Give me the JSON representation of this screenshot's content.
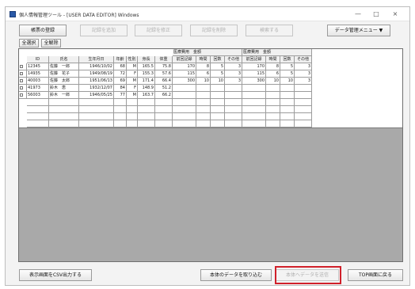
{
  "window": {
    "title": "個人情報管理ツール - [USER DATA EDITOR] Windows",
    "controls": {
      "minimize": "—",
      "maximize": "□",
      "close": "×"
    }
  },
  "toolbar": {
    "buttons": [
      {
        "label": "帳票の登録",
        "enabled": true
      },
      {
        "label": "記録を追加",
        "enabled": false
      },
      {
        "label": "記録を修正",
        "enabled": false
      },
      {
        "label": "記録を削除",
        "enabled": false
      },
      {
        "label": "検索する",
        "enabled": false
      }
    ],
    "menu_button": "データ管理メニュー ▼"
  },
  "select": {
    "all_select": "全選択",
    "all_clear": "全解除"
  },
  "table": {
    "group_headers": [
      "医療費用　金額",
      "医療費用　金額"
    ],
    "columns": [
      "ID",
      "氏名",
      "生年月日",
      "年齢",
      "性別",
      "身長",
      "体重",
      "前回記録",
      "時間",
      "回数",
      "その他",
      "前回記録",
      "時間",
      "回数",
      "その他"
    ],
    "rows": [
      [
        "12345",
        "佐藤　一郎",
        "1946/10/02",
        "68",
        "M",
        "165.5",
        "75.8",
        "170",
        "8",
        "5",
        "3",
        "170",
        "8",
        "5",
        "3"
      ],
      [
        "14935",
        "佐藤　花子",
        "1949/08/19",
        "72",
        "F",
        "155.3",
        "57.6",
        "115",
        "6",
        "5",
        "3",
        "115",
        "6",
        "5",
        "3"
      ],
      [
        "40003",
        "佐藤　太郎",
        "1951/06/13",
        "69",
        "M",
        "171.4",
        "66.4",
        "300",
        "10",
        "10",
        "3",
        "300",
        "10",
        "10",
        "3"
      ],
      [
        "41973",
        "鈴木　恵",
        "1932/12/07",
        "84",
        "F",
        "148.9",
        "51.2",
        "",
        "",
        "",
        "",
        "",
        "",
        "",
        ""
      ],
      [
        "56003",
        "鈴木　一郎",
        "1946/05/25",
        "77",
        "M",
        "163.7",
        "66.2",
        "",
        "",
        "",
        "",
        "",
        "",
        "",
        ""
      ]
    ]
  },
  "footer": {
    "export_button": "表示画面をCSV出力する",
    "read_button": "本体のデータを取り込む",
    "disabled_button": "本体へデータを送信",
    "back_button": "TOP画面に戻る"
  },
  "colors": {
    "highlight": "#d0202a",
    "grid_background": "#a9a9a9",
    "titlebar_icon": "#2a5aa8"
  }
}
